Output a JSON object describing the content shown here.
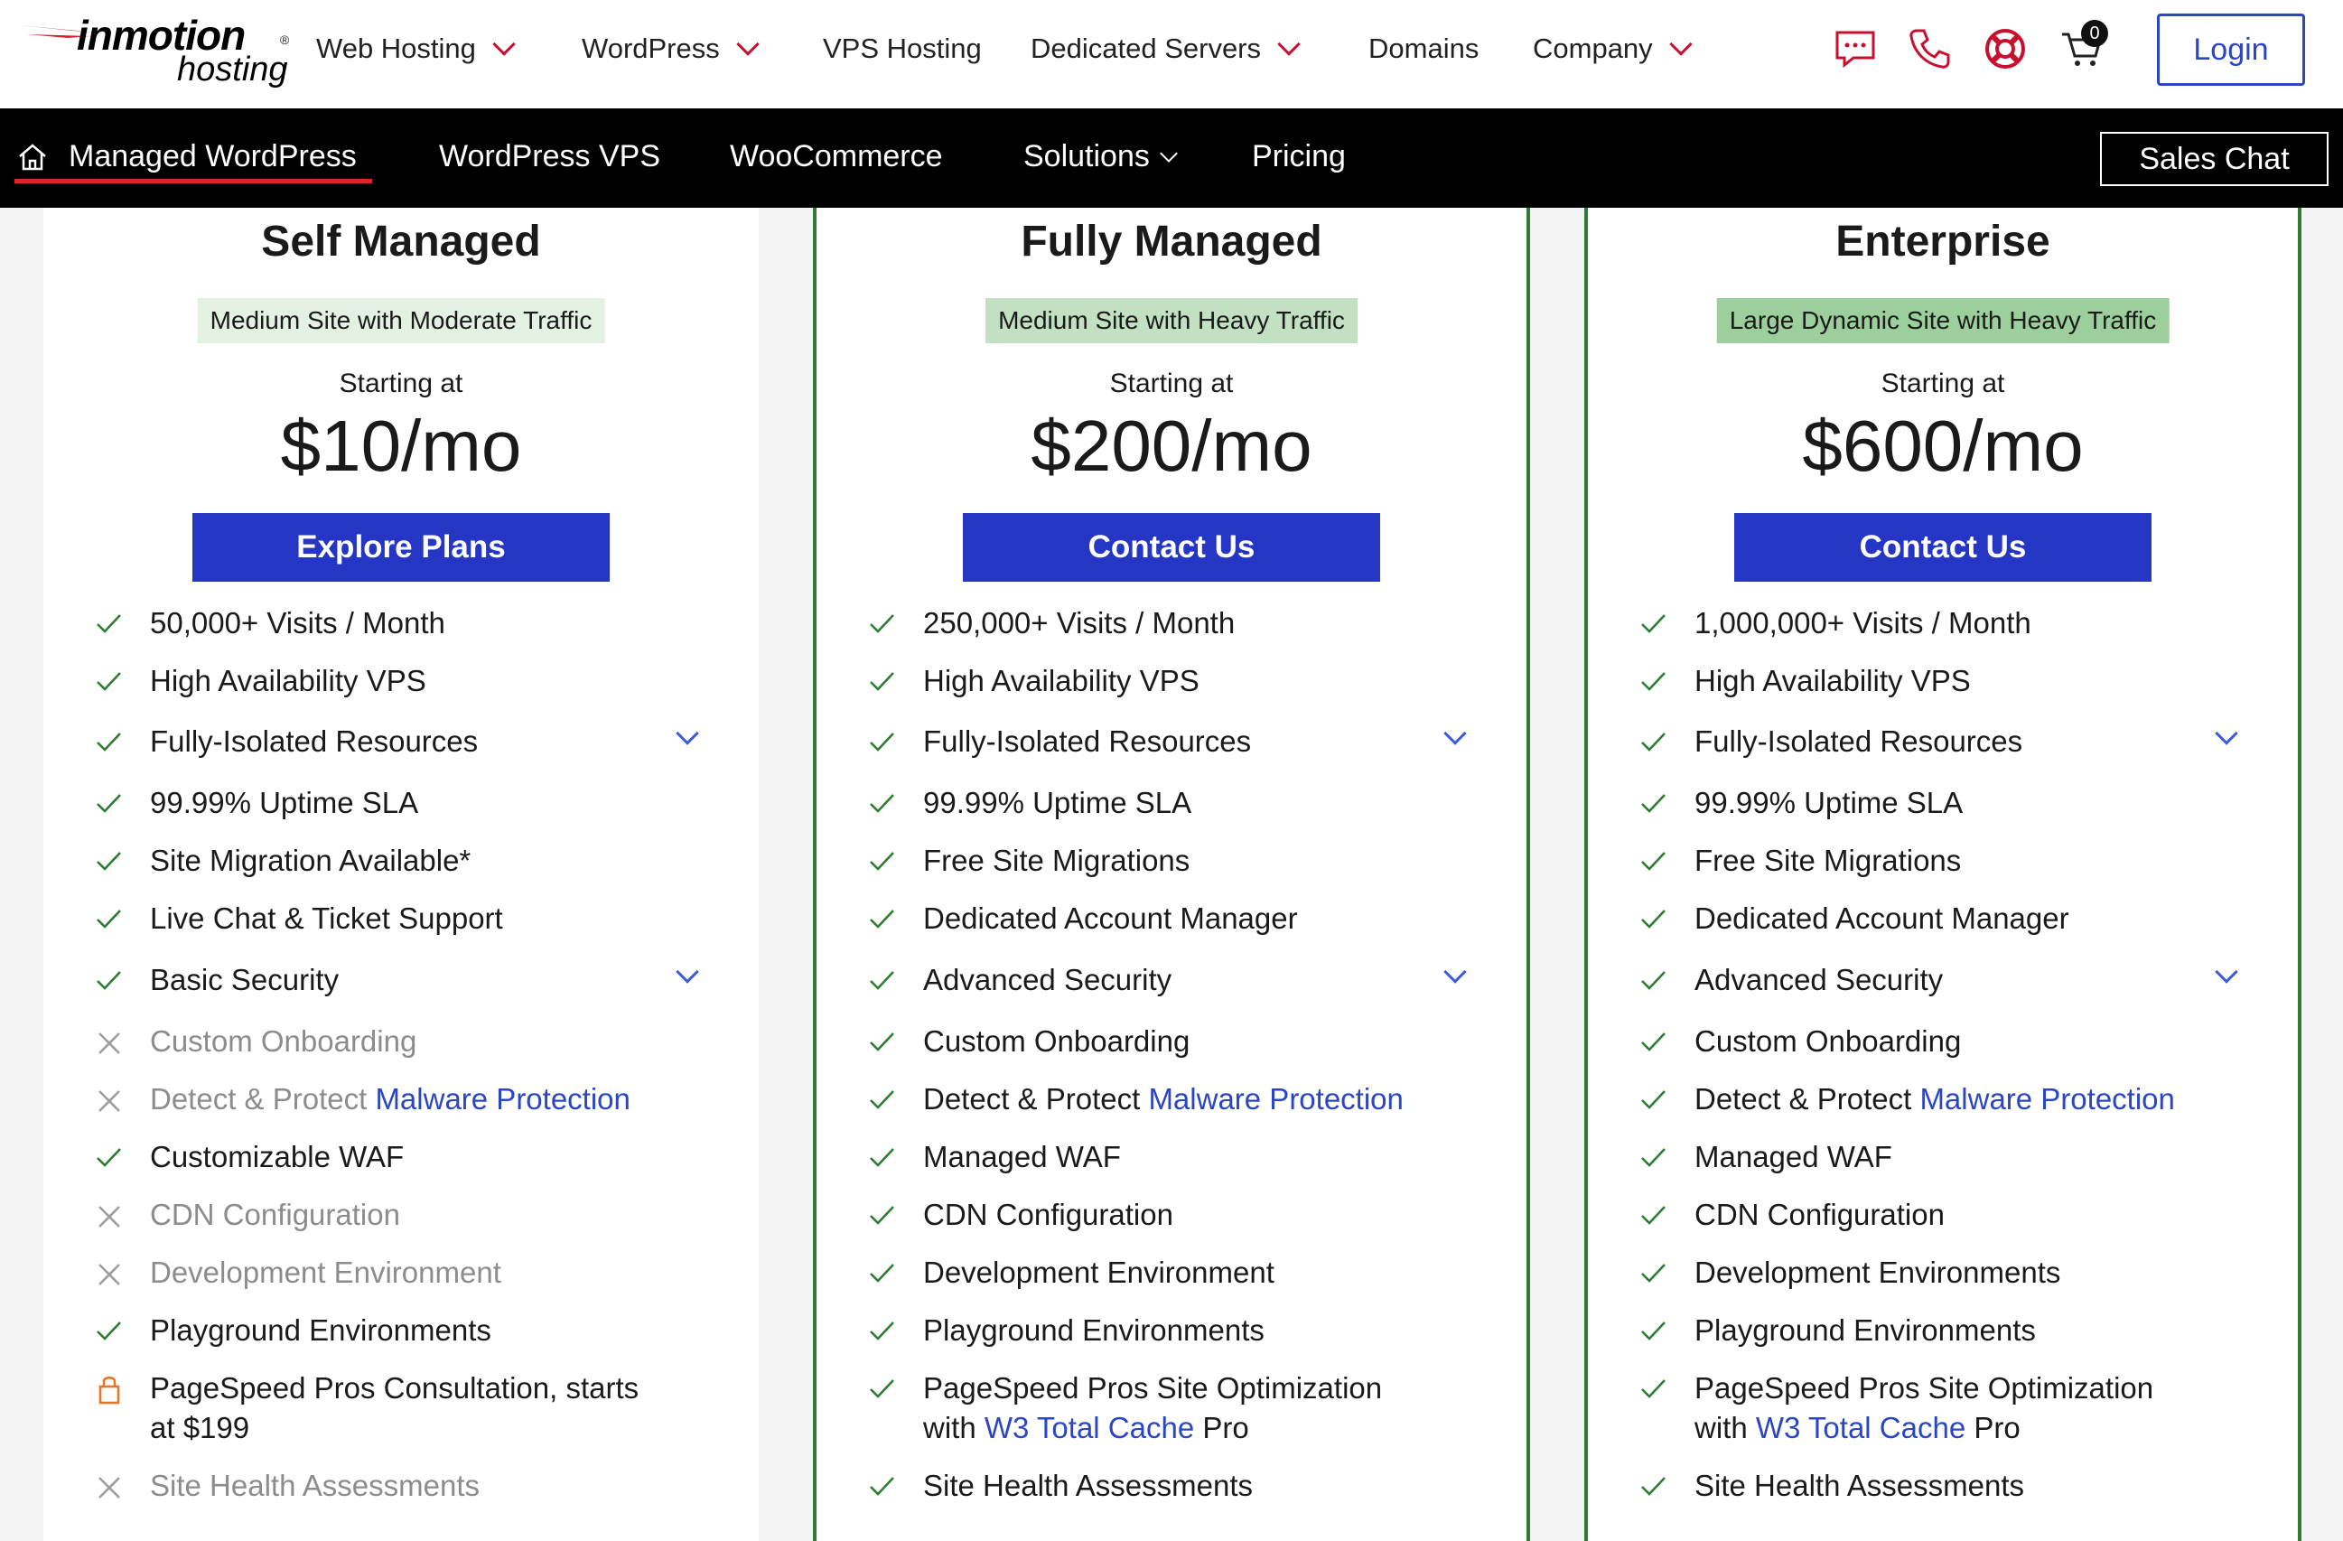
{
  "brand": {
    "logo_main": "inmotion",
    "logo_sub": "hosting",
    "logo_mark": "®"
  },
  "topnav": {
    "items": [
      "Web Hosting",
      "WordPress",
      "VPS Hosting",
      "Dedicated Servers",
      "Domains",
      "Company"
    ],
    "cart_count": "0",
    "login_label": "Login",
    "icons": [
      "chat-icon",
      "phone-icon",
      "support-icon",
      "cart-icon"
    ],
    "accent_color": "#c8102e"
  },
  "subnav": {
    "items": [
      "Managed WordPress",
      "WordPress VPS",
      "WooCommerce",
      "Solutions",
      "Pricing"
    ],
    "sales_chat_label": "Sales Chat"
  },
  "plans": [
    {
      "title": "Self Managed",
      "badge": "Medium Site with Moderate Traffic",
      "badge_color": "#e2f1e2",
      "starting": "Starting at",
      "price": "$10/mo",
      "cta": "Explore Plans",
      "features": [
        {
          "text": "50,000+ Visits / Month",
          "state": "check"
        },
        {
          "text": "High Availability VPS",
          "state": "check"
        },
        {
          "text": "Fully-Isolated Resources",
          "state": "check",
          "expand": true
        },
        {
          "text": "99.99% Uptime SLA",
          "state": "check"
        },
        {
          "text": "Site Migration Available*",
          "state": "check"
        },
        {
          "text": "Live Chat & Ticket Support",
          "state": "check"
        },
        {
          "text": "Basic Security",
          "state": "check",
          "expand": true
        },
        {
          "text": "Custom Onboarding",
          "state": "cross"
        },
        {
          "text": "Detect & Protect ",
          "link": "Malware Protection",
          "state": "cross"
        },
        {
          "text": "Customizable WAF",
          "state": "check"
        },
        {
          "text": "CDN Configuration",
          "state": "cross"
        },
        {
          "text": "Development Environment",
          "state": "cross"
        },
        {
          "text": "Playground Environments",
          "state": "check"
        },
        {
          "text": "PageSpeed Pros Consultation, starts",
          "text2": "at $199",
          "state": "lock"
        },
        {
          "text": "Site Health Assessments",
          "state": "cross"
        }
      ]
    },
    {
      "title": "Fully Managed",
      "badge": "Medium Site with Heavy Traffic",
      "badge_color": "#c2e0c2",
      "starting": "Starting at",
      "price": "$200/mo",
      "cta": "Contact Us",
      "features": [
        {
          "text": "250,000+ Visits / Month",
          "state": "check"
        },
        {
          "text": "High Availability VPS",
          "state": "check"
        },
        {
          "text": "Fully-Isolated Resources",
          "state": "check",
          "expand": true
        },
        {
          "text": "99.99% Uptime SLA",
          "state": "check"
        },
        {
          "text": "Free Site Migrations",
          "state": "check"
        },
        {
          "text": "Dedicated Account Manager",
          "state": "check"
        },
        {
          "text": "Advanced Security",
          "state": "check",
          "expand": true
        },
        {
          "text": "Custom Onboarding",
          "state": "check"
        },
        {
          "text": "Detect & Protect ",
          "link": "Malware Protection",
          "state": "check"
        },
        {
          "text": "Managed WAF",
          "state": "check"
        },
        {
          "text": "CDN Configuration",
          "state": "check"
        },
        {
          "text": "Development Environment",
          "state": "check"
        },
        {
          "text": "Playground Environments",
          "state": "check"
        },
        {
          "text": "PageSpeed Pros Site Optimization",
          "text2_pre": "with ",
          "text2_link": "W3 Total Cache",
          "text2_post": " Pro",
          "state": "check"
        },
        {
          "text": "Site Health Assessments",
          "state": "check"
        }
      ]
    },
    {
      "title": "Enterprise",
      "badge": "Large Dynamic Site with Heavy Traffic",
      "badge_color": "#9ccf9c",
      "starting": "Starting at",
      "price": "$600/mo",
      "cta": "Contact Us",
      "features": [
        {
          "text": "1,000,000+ Visits / Month",
          "state": "check"
        },
        {
          "text": "High Availability VPS",
          "state": "check"
        },
        {
          "text": "Fully-Isolated Resources",
          "state": "check",
          "expand": true
        },
        {
          "text": "99.99% Uptime SLA",
          "state": "check"
        },
        {
          "text": "Free Site Migrations",
          "state": "check"
        },
        {
          "text": "Dedicated Account Manager",
          "state": "check"
        },
        {
          "text": "Advanced Security",
          "state": "check",
          "expand": true
        },
        {
          "text": "Custom Onboarding",
          "state": "check"
        },
        {
          "text": "Detect & Protect ",
          "link": "Malware Protection",
          "state": "check"
        },
        {
          "text": "Managed WAF",
          "state": "check"
        },
        {
          "text": "CDN Configuration",
          "state": "check"
        },
        {
          "text": "Development Environments",
          "state": "check"
        },
        {
          "text": "Playground Environments",
          "state": "check"
        },
        {
          "text": "PageSpeed Pros Site Optimization",
          "text2_pre": "with ",
          "text2_link": "W3 Total Cache",
          "text2_post": " Pro",
          "state": "check"
        },
        {
          "text": "Site Health Assessments",
          "state": "check"
        }
      ]
    }
  ]
}
